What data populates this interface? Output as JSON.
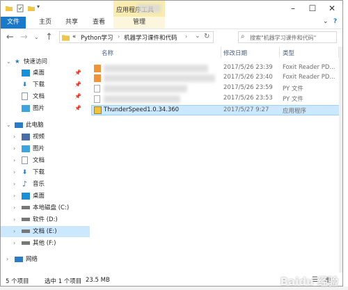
{
  "titlebar": {
    "context_tab": "应用程序工具"
  },
  "ribbon": {
    "tabs": [
      "文件",
      "主页",
      "共享",
      "查看"
    ],
    "manage": "管理",
    "help": "?"
  },
  "address": {
    "segments": [
      "«",
      "Python学习",
      "机器学习课件和代码"
    ],
    "search_placeholder": "搜索\"机器学习课件和代码\""
  },
  "nav": {
    "quick_access": "快速访问",
    "quick_items": [
      "桌面",
      "下载",
      "文档",
      "图片"
    ],
    "this_pc": "此电脑",
    "pc_items": [
      "视频",
      "图片",
      "文档",
      "下载",
      "音乐",
      "桌面",
      "本地磁盘 (C:)",
      "软件 (D:)",
      "文档 (E:)",
      "其他 (F:)"
    ],
    "network": "网络"
  },
  "columns": {
    "name": "名称",
    "date": "修改日期",
    "type": "类型"
  },
  "files": [
    {
      "name": "",
      "date": "2017/5/26 23:39",
      "type": "Foxit Reader PD..."
    },
    {
      "name": "",
      "date": "2017/5/26 23:40",
      "type": "Foxit Reader PD..."
    },
    {
      "name": "",
      "date": "2017/5/26 23:59",
      "type": "PY 文件"
    },
    {
      "name": "",
      "date": "2017/5/26 23:53",
      "type": "PY 文件"
    },
    {
      "name": "ThunderSpeed1.0.34.360",
      "date": "2017/5/27 9:27",
      "type": "应用程序"
    }
  ],
  "status": {
    "count": "5 个项目",
    "selected": "选中 1 个项目",
    "size": "23.5 MB"
  },
  "watermark": "Baidu 经验",
  "colors": {
    "accent": "#1979ca",
    "selection": "#cce8ff",
    "context": "#f9ecb0"
  }
}
